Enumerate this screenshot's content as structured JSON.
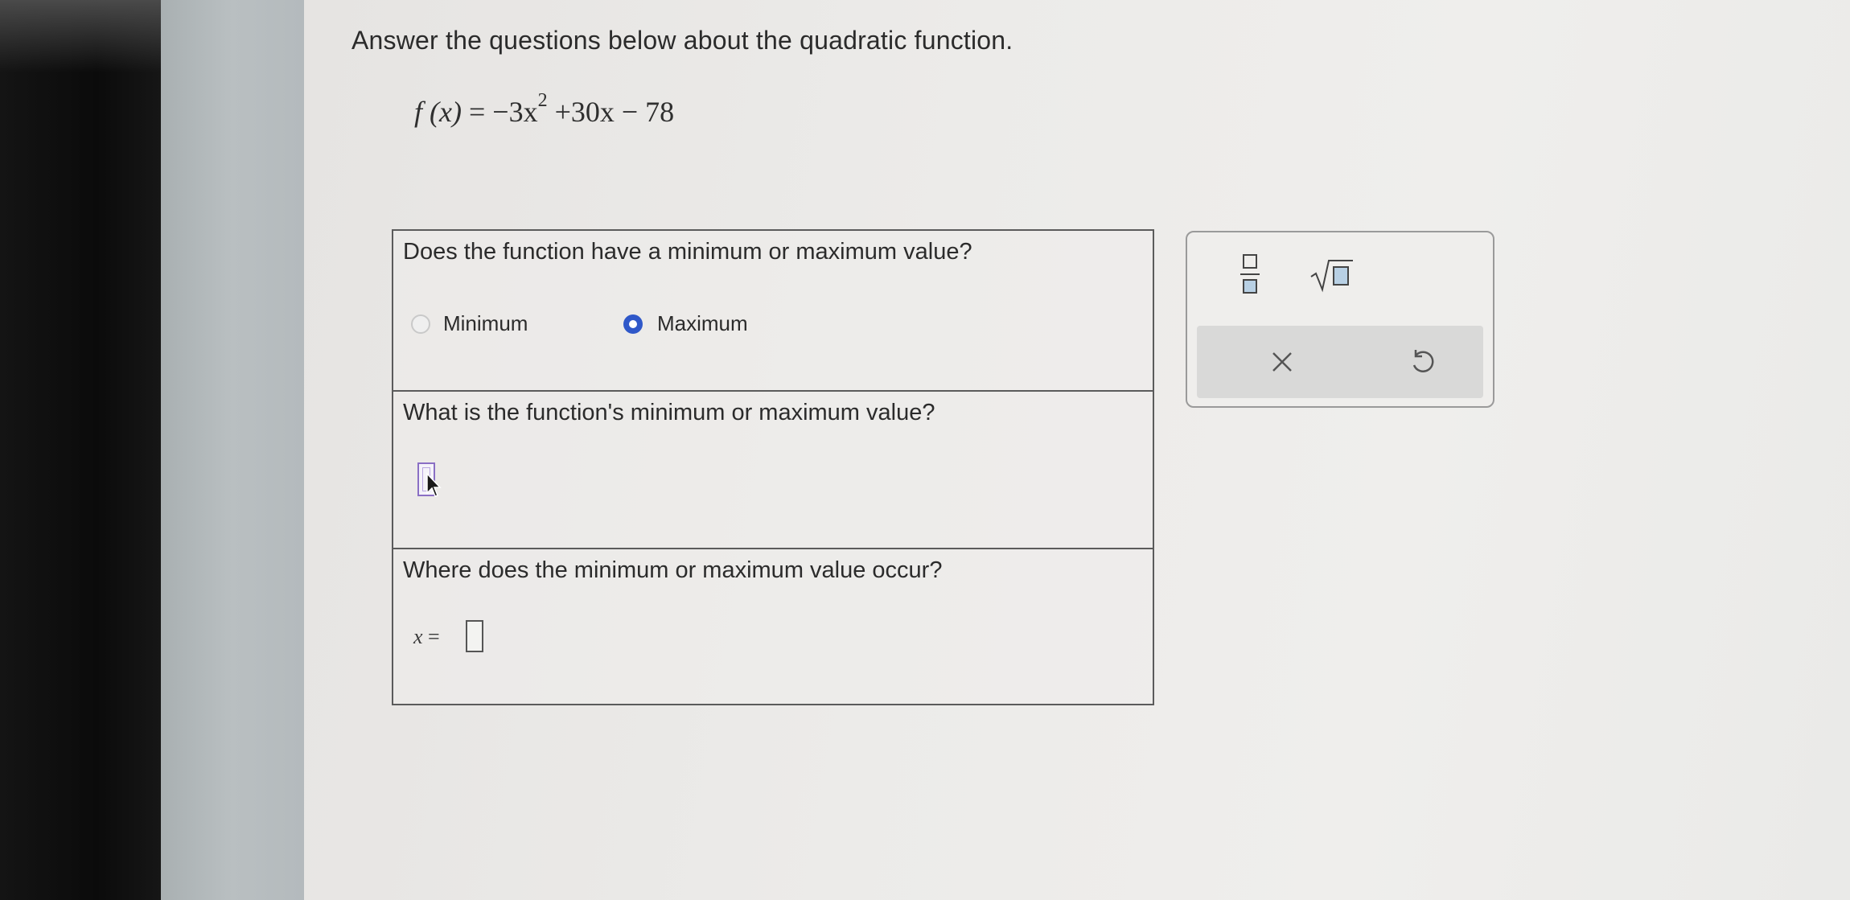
{
  "header": {
    "instruction": "Answer the questions below about the quadratic function.",
    "equation": {
      "lhs": "f (x)",
      "eq": " = −3x",
      "exponent": "2",
      "rest": " +30x − 78"
    }
  },
  "questions": [
    {
      "text": "Does the function have a minimum or maximum value?",
      "options": [
        {
          "label": "Minimum",
          "selected": false
        },
        {
          "label": "Maximum",
          "selected": true
        }
      ]
    },
    {
      "text": "What is the function's minimum or maximum value?",
      "answer": ""
    },
    {
      "text": "Where does the minimum or maximum value occur?",
      "answer_prefix_var": "x",
      "answer_prefix_eq": " =",
      "answer": ""
    }
  ],
  "toolbar": {
    "buttons": [
      "fraction-icon",
      "square-root-icon"
    ],
    "actions": [
      "close-icon",
      "undo-icon"
    ]
  },
  "colors": {
    "selected_radio": "#2f58c9",
    "active_input_border": "#8a6fc4"
  }
}
